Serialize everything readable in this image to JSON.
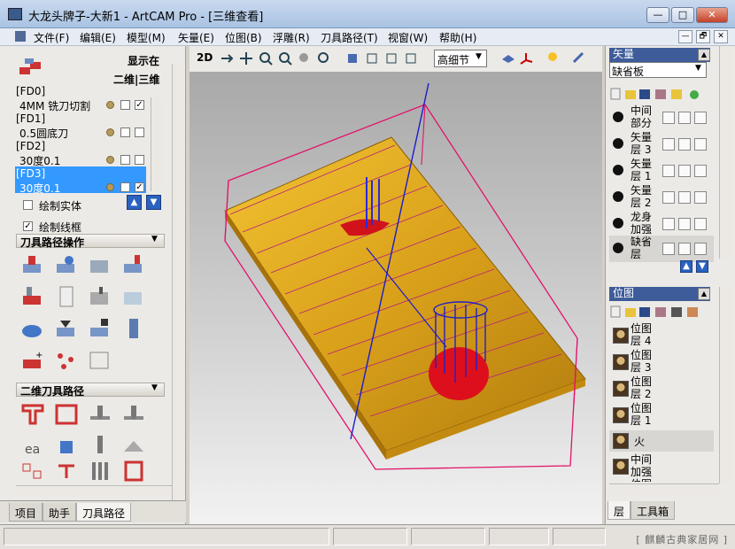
{
  "window": {
    "title": "大龙头牌子-大新1 - ArtCAM Pro - [三维查看]",
    "min": "—",
    "max": "□",
    "close": "✕"
  },
  "menu": [
    "文件(F)",
    "编辑(E)",
    "模型(M)",
    "矢量(E)",
    "位图(B)",
    "浮雕(R)",
    "刀具路径(T)",
    "视窗(W)",
    "帮助(H)"
  ],
  "mdi": [
    "—",
    "🗗",
    "✕"
  ],
  "left": {
    "display_in": "显示在",
    "dims": "二维|三维",
    "toolpaths": [
      {
        "id": "[FD0]",
        "name": "4MM 铣刀切割",
        "d2": false,
        "d3": true
      },
      {
        "id": "[FD1]",
        "name": "0.5圆底刀",
        "d2": false,
        "d3": false
      },
      {
        "id": "[FD2]",
        "name": "30度0.1",
        "d2": false,
        "d3": false
      },
      {
        "id": "[FD3]",
        "name": "30度0.1",
        "d2": false,
        "d3": true,
        "selected": true
      }
    ],
    "draw_solid": "绘制实体",
    "draw_wire": "绘制线框",
    "ops_title": "刀具路径操作",
    "twod_title": "二维刀具路径"
  },
  "tabs": [
    "项目",
    "助手",
    "刀具路径"
  ],
  "toolbar": {
    "mode": "2D",
    "quality": "高细节"
  },
  "right": {
    "vector_title": "矢量",
    "vector_sheet": "缺省板",
    "vector_layers": [
      "中间部分",
      "矢量层 3",
      "矢量层 1",
      "矢量层 2",
      "龙身加强",
      "缺省层"
    ],
    "bitmap_title": "位图",
    "bitmap_layers": [
      "位图层 4",
      "位图层 3",
      "位图层 2",
      "位图层 1",
      "火",
      "中间加强位图"
    ],
    "tabs": [
      "层",
      "工具箱"
    ]
  },
  "status": {
    "watermark": "[ 麒麟古典家居网 ]"
  },
  "colors": {
    "relief": "#e7b21a",
    "toolpath": "#e3126a",
    "cutter": "#1a1ad0",
    "selection": "#3399ff",
    "panel_title": "#3e5c9a"
  }
}
